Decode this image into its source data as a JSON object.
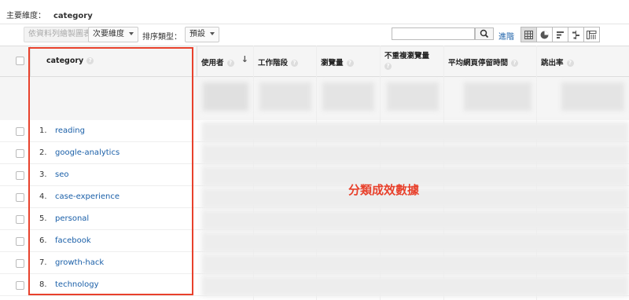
{
  "header": {
    "primary_label": "主要維度：",
    "primary_value": "category"
  },
  "toolbar": {
    "plot_rows": "依資料列繪製圖表",
    "secondary_dim": "次要維度",
    "sort_type_label": "排序類型：",
    "sort_default": "預設",
    "advanced": "進階"
  },
  "table": {
    "columns": [
      "category",
      "使用者",
      "工作階段",
      "瀏覽量",
      "不重複瀏覽量",
      "平均網頁停留時間",
      "跳出率"
    ],
    "rows": [
      {
        "index": "1.",
        "label": "reading"
      },
      {
        "index": "2.",
        "label": "google-analytics"
      },
      {
        "index": "3.",
        "label": "seo"
      },
      {
        "index": "4.",
        "label": "case-experience"
      },
      {
        "index": "5.",
        "label": "personal"
      },
      {
        "index": "6.",
        "label": "facebook"
      },
      {
        "index": "7.",
        "label": "growth-hack"
      },
      {
        "index": "8.",
        "label": "technology"
      }
    ]
  },
  "annotation": "分類成效數據",
  "colors": {
    "link": "#1a5fa8",
    "highlight": "#e8412c"
  }
}
